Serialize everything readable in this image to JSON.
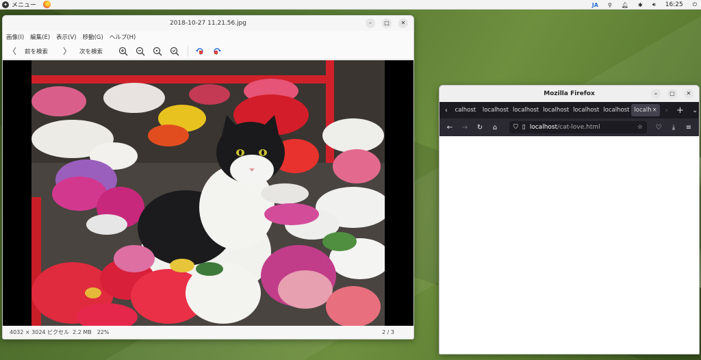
{
  "topbar": {
    "menu_label": "メニュー",
    "input_method": "JA",
    "clock": "16:25"
  },
  "viewer": {
    "title": "2018-10-27 11.21.56.jpg",
    "menu": [
      "画像(I)",
      "編集(E)",
      "表示(V)",
      "移動(G)",
      "ヘルプ(H)"
    ],
    "prev_label": "前を検索",
    "next_label": "次を検索",
    "status": {
      "dimensions": "4032 × 3024 ピクセル",
      "size": "2.2 MB",
      "zoom": "22%",
      "page": "2 / 3"
    }
  },
  "firefox": {
    "title": "Mozilla Firefox",
    "tabs": [
      "calhost",
      "localhost",
      "localhost",
      "localhost",
      "localhost",
      "localhost"
    ],
    "active_tab": "localh",
    "url_host": "localhost",
    "url_path": "/cat-love.html"
  }
}
